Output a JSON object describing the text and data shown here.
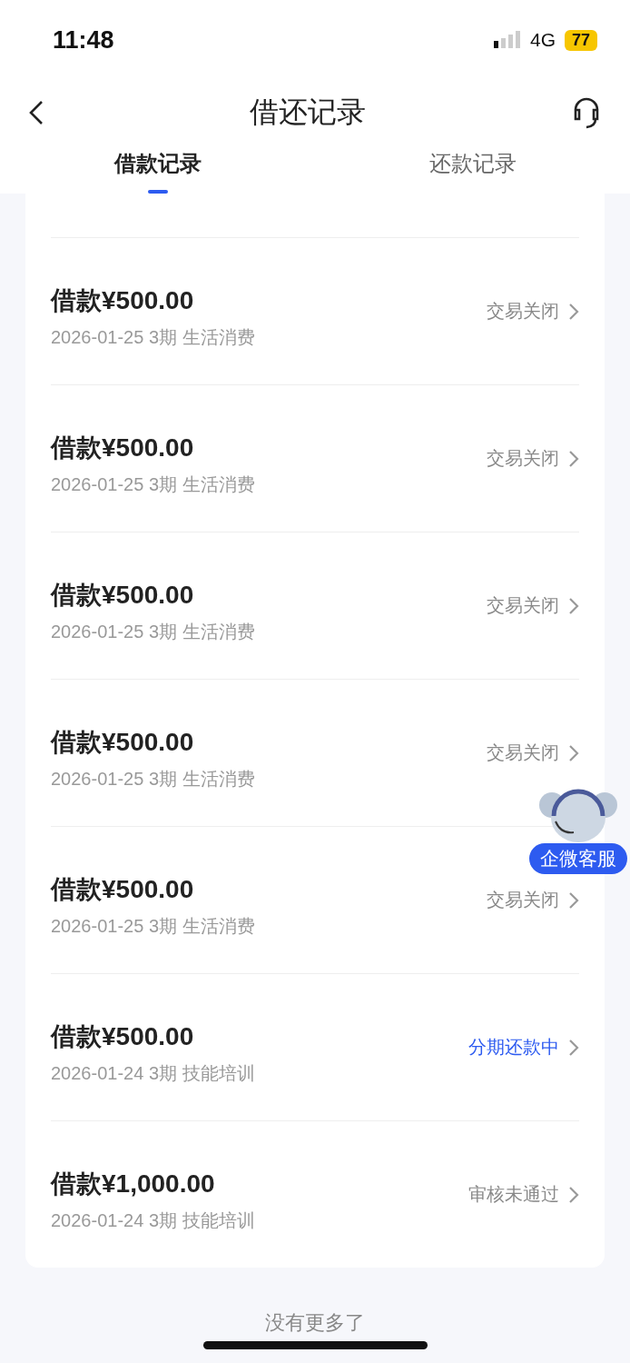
{
  "status_bar": {
    "time": "11:48",
    "network": "4G",
    "battery": "77"
  },
  "nav": {
    "title": "借还记录"
  },
  "tabs": [
    {
      "label": "借款记录",
      "selected": true
    },
    {
      "label": "还款记录",
      "selected": false
    }
  ],
  "records": [
    {
      "amount": "借款¥500.00",
      "date": "2026-01-25",
      "term": "3期",
      "purpose": "生活消费",
      "status": "交易关闭",
      "kind": "closed"
    },
    {
      "amount": "借款¥500.00",
      "date": "2026-01-25",
      "term": "3期",
      "purpose": "生活消费",
      "status": "交易关闭",
      "kind": "closed"
    },
    {
      "amount": "借款¥500.00",
      "date": "2026-01-25",
      "term": "3期",
      "purpose": "生活消费",
      "status": "交易关闭",
      "kind": "closed"
    },
    {
      "amount": "借款¥500.00",
      "date": "2026-01-25",
      "term": "3期",
      "purpose": "生活消费",
      "status": "交易关闭",
      "kind": "closed"
    },
    {
      "amount": "借款¥500.00",
      "date": "2026-01-25",
      "term": "3期",
      "purpose": "生活消费",
      "status": "交易关闭",
      "kind": "closed"
    },
    {
      "amount": "借款¥500.00",
      "date": "2026-01-24",
      "term": "3期",
      "purpose": "技能培训",
      "status": "分期还款中",
      "kind": "active"
    },
    {
      "amount": "借款¥1,000.00",
      "date": "2026-01-24",
      "term": "3期",
      "purpose": "技能培训",
      "status": "审核未通过",
      "kind": "rejected"
    }
  ],
  "floating_service": {
    "label": "企微客服"
  },
  "footer": "没有更多了"
}
